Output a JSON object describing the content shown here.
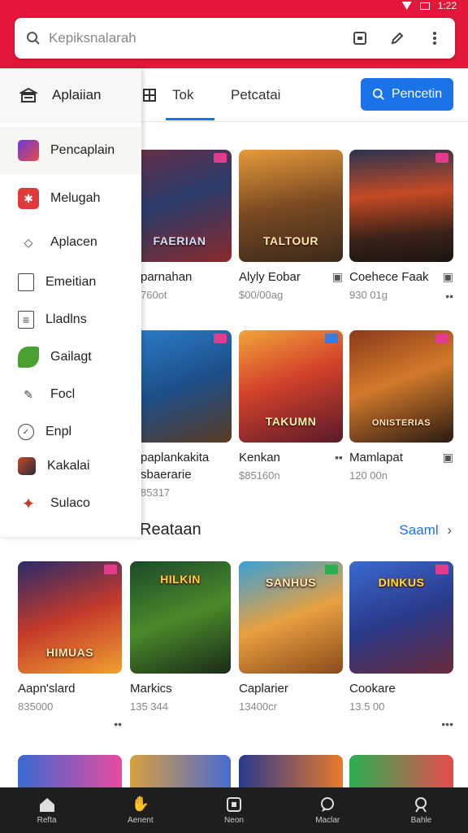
{
  "status": {
    "time": "1:22"
  },
  "search": {
    "placeholder": "Kepiksnalarah"
  },
  "tabs": [
    {
      "label": "Aplaiian"
    },
    {
      "label": "Tok"
    },
    {
      "label": "Petcatai"
    }
  ],
  "tab_button": {
    "label": "Pencetin"
  },
  "drawer": {
    "items": [
      {
        "label": "Pencaplain"
      },
      {
        "label": "Melugah"
      },
      {
        "label": "Aplacen"
      },
      {
        "label": "Emeitian"
      },
      {
        "label": "Lladlns"
      },
      {
        "label": "Gailagt"
      },
      {
        "label": "Focl"
      },
      {
        "label": "Enpl"
      },
      {
        "label": "Kakalai"
      },
      {
        "label": "Sulaco"
      }
    ]
  },
  "row1": [
    {
      "name": "parnahan",
      "meta": "760ot",
      "art_title": "FAERIAN"
    },
    {
      "name": "Alyly Eobar",
      "meta": "$00/00ag",
      "art_title": "TALTOUR"
    },
    {
      "name": "Coehece Faak",
      "meta": "930 01g",
      "art_title": ""
    }
  ],
  "row2": [
    {
      "name": "paplankakita",
      "name2": "sbaerarie",
      "meta": "85317",
      "art_title": ""
    },
    {
      "name": "Kenkan",
      "meta": "$85160n",
      "art_title": "TAKUMN"
    },
    {
      "name": "Mamlapat",
      "meta": "120 00n",
      "art_title": "ONISTERIAS"
    }
  ],
  "section": {
    "title": "Reataan",
    "more": "Saaml"
  },
  "row3": [
    {
      "name": "Aapn'slard",
      "meta": "835000",
      "art_title": "HIMUAS"
    },
    {
      "name": "Markics",
      "meta": "135 344",
      "art_title": "HILKIN"
    },
    {
      "name": "Caplarier",
      "meta": "13400cr",
      "art_title": "SANHUS"
    },
    {
      "name": "Cookare",
      "meta": "13.5 00",
      "art_title": "DINKUS"
    }
  ],
  "bottomnav": [
    {
      "label": "Refta"
    },
    {
      "label": "Aenent"
    },
    {
      "label": "Neon"
    },
    {
      "label": "Maclar"
    },
    {
      "label": "Bahle"
    }
  ]
}
